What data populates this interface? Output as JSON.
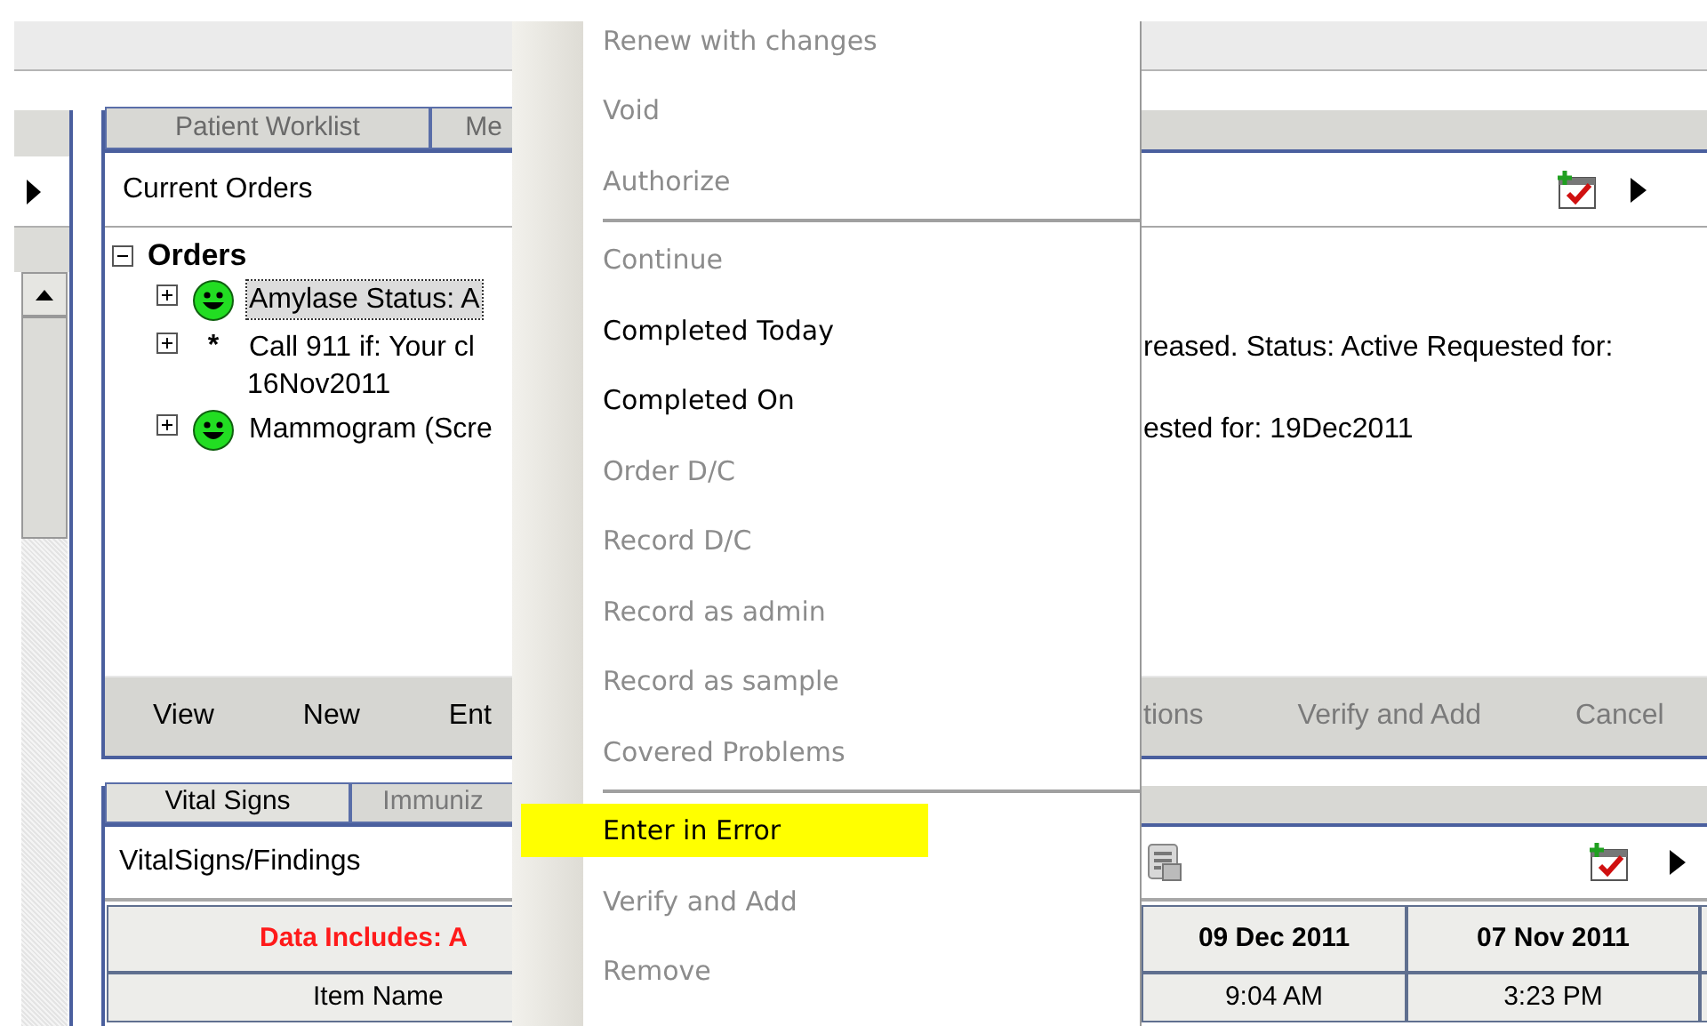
{
  "orders_panel": {
    "tabs": [
      {
        "label": "Patient Worklist",
        "selected": false
      },
      {
        "label": "Me",
        "selected": false
      }
    ],
    "header": "Current Orders",
    "tree": {
      "label": "Orders",
      "expanded": true,
      "children": [
        {
          "kind": "smiley",
          "left": "Amylase  Status: A",
          "focused": true,
          "expanded": false
        },
        {
          "kind": "marker",
          "marker": "*",
          "left": "Call 911 if: Your cl",
          "right": "reased.  Status: Active  Requested for:",
          "continuation": "16Nov2011",
          "focused": false,
          "expanded": false
        },
        {
          "kind": "smiley",
          "left": "Mammogram (Scre",
          "right": "ested for: 19Dec2011",
          "focused": false,
          "expanded": false
        }
      ]
    },
    "buttons_left": [
      {
        "label": "View",
        "disabled": false
      },
      {
        "label": "New",
        "disabled": false
      },
      {
        "label": "Ent",
        "disabled": false
      }
    ],
    "buttons_right": [
      {
        "label": "tions",
        "disabled": true
      },
      {
        "label": "Verify and Add",
        "disabled": true
      },
      {
        "label": "Cancel",
        "disabled": true
      }
    ]
  },
  "vitals_panel": {
    "tabs": [
      {
        "label": "Vital Signs",
        "selected": true
      },
      {
        "label": "Immuniz",
        "selected": false
      }
    ],
    "header": "VitalSigns/Findings",
    "table": {
      "columns": [
        "Data Includes: A",
        "09 Dec 2011",
        "07 Nov 2011"
      ],
      "rows": [
        [
          "Item Name",
          "9:04 AM",
          "3:23 PM"
        ]
      ]
    }
  },
  "context_menu": {
    "items": [
      {
        "kind": "item",
        "label": "Renew with changes",
        "disabled": true,
        "highlighted": false
      },
      {
        "kind": "item",
        "label": "Void",
        "disabled": true,
        "highlighted": false
      },
      {
        "kind": "item",
        "label": "Authorize",
        "disabled": true,
        "highlighted": false
      },
      {
        "kind": "separator"
      },
      {
        "kind": "item",
        "label": "Continue",
        "disabled": true,
        "highlighted": false
      },
      {
        "kind": "item",
        "label": "Completed Today",
        "disabled": false,
        "highlighted": false
      },
      {
        "kind": "item",
        "label": "Completed On",
        "disabled": false,
        "highlighted": false
      },
      {
        "kind": "item",
        "label": "Order D/C",
        "disabled": true,
        "highlighted": false
      },
      {
        "kind": "item",
        "label": "Record D/C",
        "disabled": true,
        "highlighted": false
      },
      {
        "kind": "item",
        "label": "Record as admin",
        "disabled": true,
        "highlighted": false
      },
      {
        "kind": "item",
        "label": "Record as sample",
        "disabled": true,
        "highlighted": false
      },
      {
        "kind": "item",
        "label": "Covered Problems",
        "disabled": true,
        "highlighted": false
      },
      {
        "kind": "separator"
      },
      {
        "kind": "item",
        "label": "Enter in Error",
        "disabled": false,
        "highlighted": true
      },
      {
        "kind": "item",
        "label": "Verify and Add",
        "disabled": true,
        "highlighted": false
      },
      {
        "kind": "item",
        "label": "Remove",
        "disabled": true,
        "highlighted": false
      }
    ]
  }
}
